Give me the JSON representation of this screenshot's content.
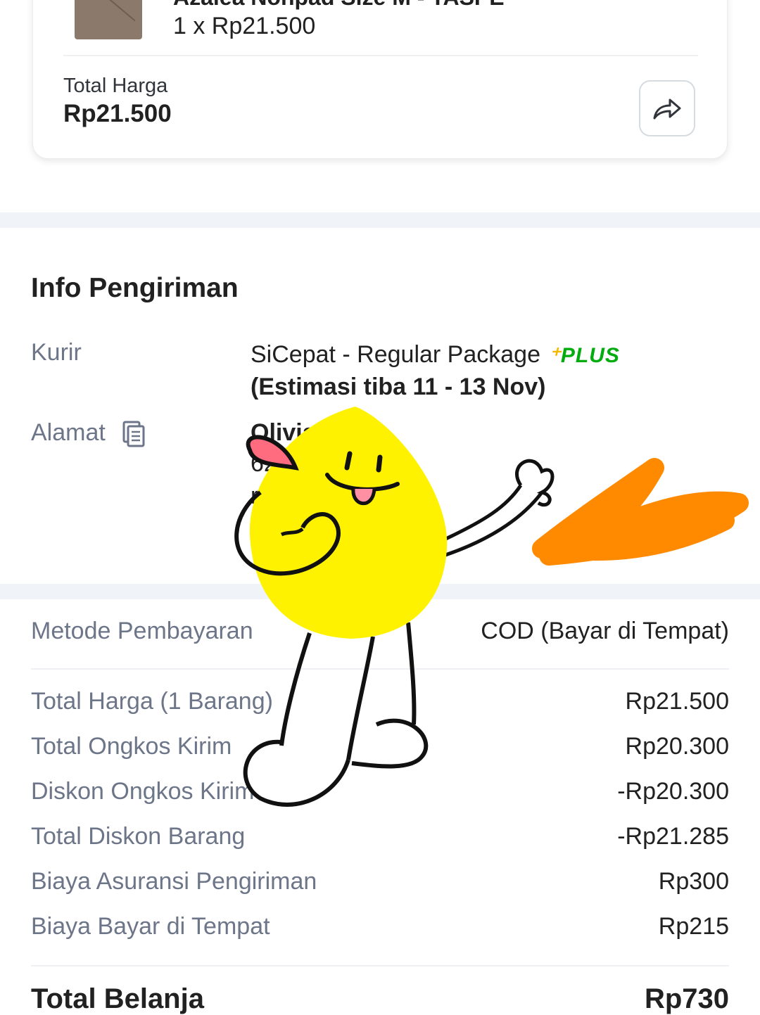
{
  "product": {
    "name": "Azalea Nonpad Size M - TASPE",
    "qty_price": "1 x Rp21.500",
    "total_label": "Total Harga",
    "total_value": "Rp21.500",
    "share_icon": "share-arrow-icon"
  },
  "shipping": {
    "title": "Info Pengiriman",
    "courier_label": "Kurir",
    "courier_name": "SiCepat - Regular Package",
    "courier_badge": "PLUS",
    "courier_eta": "(Estimasi tiba 11 - 13 Nov)",
    "address_label": "Alamat",
    "address_icon": "copy-document-icon",
    "address_lines": [
      "Olivia",
      "62",
      "r",
      "S"
    ]
  },
  "payment": {
    "method_label": "Metode Pembayaran",
    "method_value": "COD (Bayar di Tempat)",
    "rows": [
      {
        "label": "Total Harga (1 Barang)",
        "value": "Rp21.500"
      },
      {
        "label": "Total Ongkos Kirim",
        "value": "Rp20.300"
      },
      {
        "label": "Diskon Ongkos Kirim",
        "value": "-Rp20.300"
      },
      {
        "label": "Total Diskon Barang",
        "value": "-Rp21.285"
      },
      {
        "label": "Biaya Asuransi Pengiriman",
        "value": "Rp300"
      },
      {
        "label": "Biaya Bayar di Tempat",
        "value": "Rp215"
      }
    ],
    "grand_label": "Total Belanja",
    "grand_value": "Rp730"
  },
  "colors": {
    "plus_green": "#03ac0e",
    "sticker_yellow": "#fff200",
    "scribble_orange": "#ff8a00"
  }
}
